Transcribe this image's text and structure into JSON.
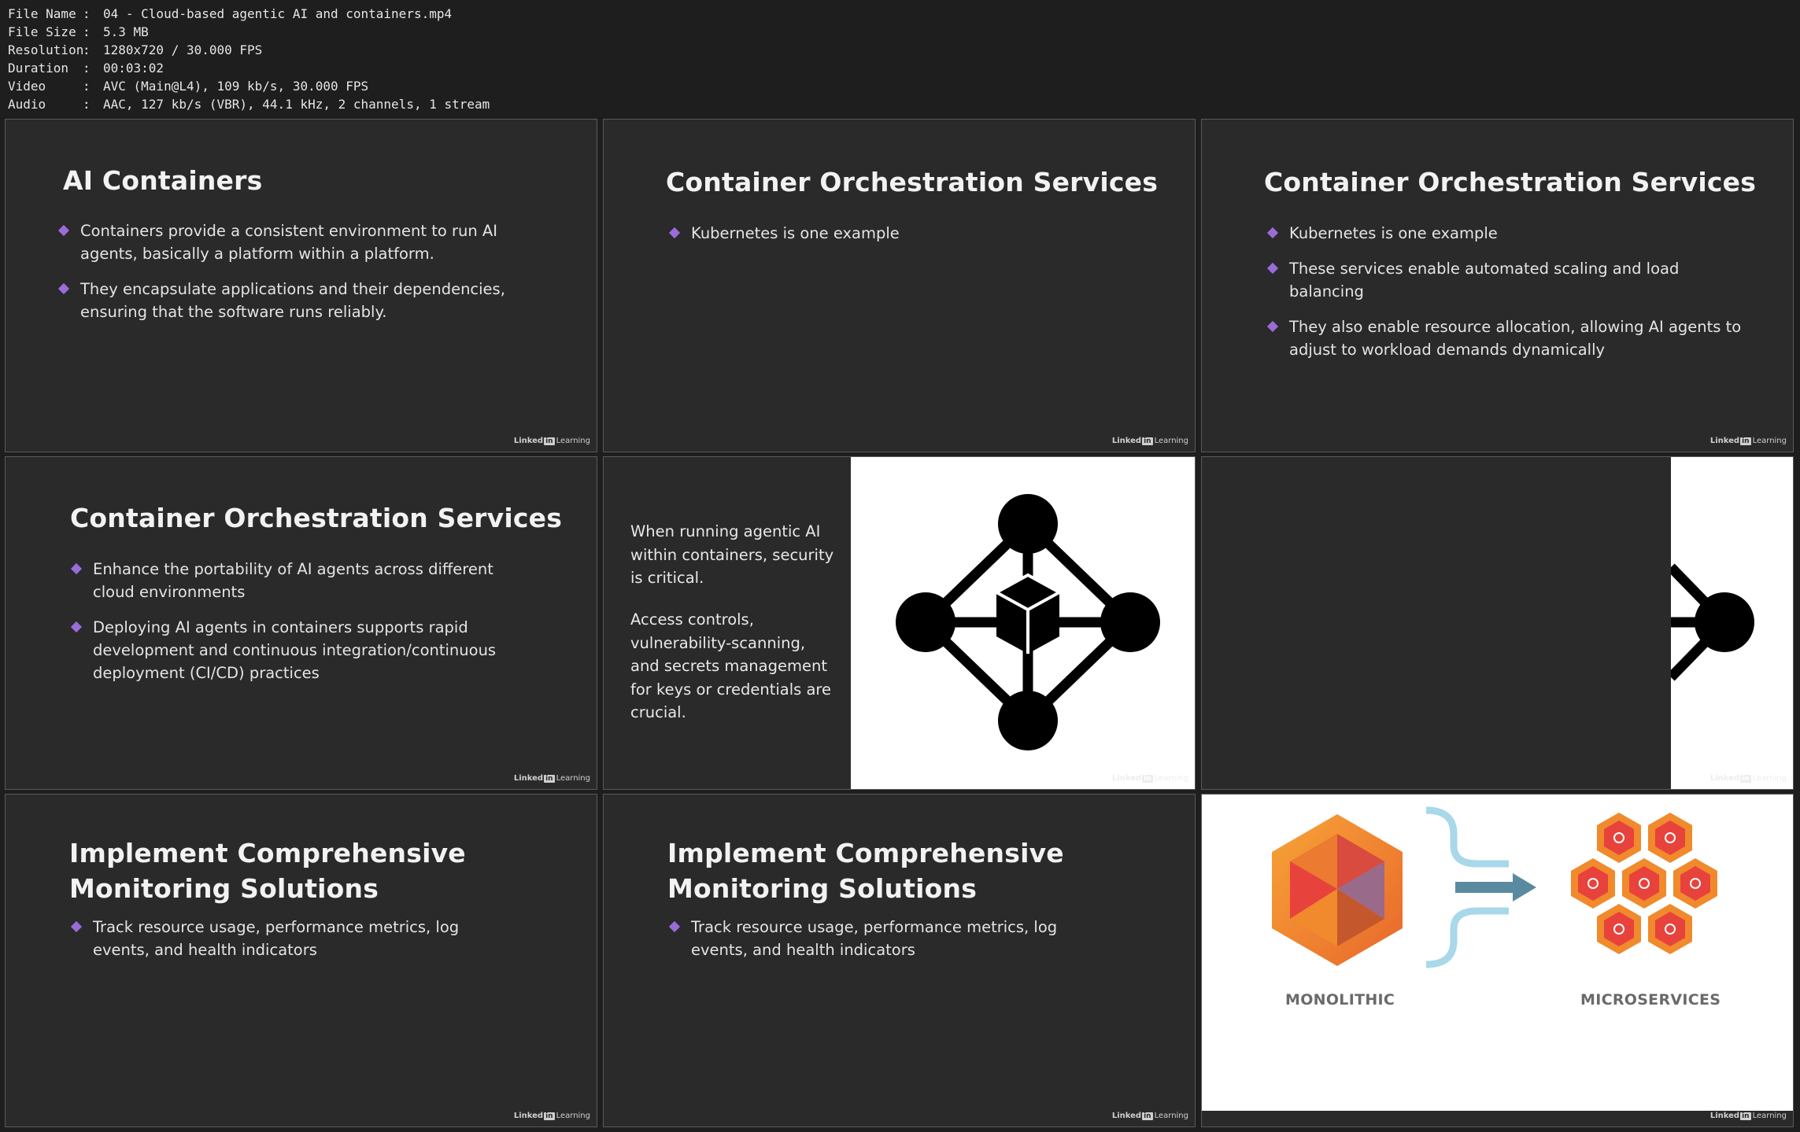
{
  "file_info": [
    {
      "key": "File Name",
      "value": "04 - Cloud-based agentic AI and containers.mp4"
    },
    {
      "key": "File Size",
      "value": "5.3 MB"
    },
    {
      "key": "Resolution",
      "value": "1280x720 / 30.000 FPS"
    },
    {
      "key": "Duration",
      "value": "00:03:02"
    },
    {
      "key": "Video",
      "value": "AVC (Main@L4), 109 kb/s, 30.000 FPS"
    },
    {
      "key": "Audio",
      "value": "AAC, 127 kb/s (VBR), 44.1 kHz, 2 channels, 1 stream"
    }
  ],
  "brand": {
    "linked": "Linked",
    "in": "in",
    "learning": "Learning"
  },
  "slides": {
    "s1": {
      "title": "AI Containers",
      "bullets": [
        "Containers provide a consistent environment to run AI agents, basically a platform within a platform.",
        "They encapsulate applications and their dependencies, ensuring that the software runs reliably."
      ]
    },
    "s2": {
      "title": "Container Orchestration Services",
      "bullets": [
        "Kubernetes is one example"
      ]
    },
    "s3": {
      "title": "Container Orchestration Services",
      "bullets": [
        "Kubernetes is one example",
        "These services enable automated scaling and load balancing",
        "They also enable resource allocation, allowing AI agents to adjust to workload demands dynamically"
      ]
    },
    "s4": {
      "title": "Container Orchestration Services",
      "bullets": [
        "Enhance the portability of AI agents across different cloud environments",
        "Deploying AI agents in containers supports rapid development and continuous integration/continuous deployment (CI/CD) practices"
      ]
    },
    "s5": {
      "para1": "When running agentic AI within containers, security is critical.",
      "para2": "Access controls, vulnerability-scanning, and secrets management for keys or credentials are crucial.",
      "icon": "container-network-icon"
    },
    "s7": {
      "title": "Implement Comprehensive Monitoring Solutions",
      "bullets": [
        "Track resource usage, performance metrics, log events, and health indicators"
      ]
    },
    "s8": {
      "title": "Implement Comprehensive Monitoring Solutions",
      "bullets": [
        "Track resource usage, performance metrics, log events, and health indicators"
      ]
    },
    "s9": {
      "left_label": "MONOLITHIC",
      "right_label": "MICROSERVICES"
    }
  },
  "colors": {
    "slide_bg": "#2a2a2a",
    "bullet_accent": "#9b6cd9",
    "hex_orange": "#f08a2c",
    "hex_red": "#e8423c",
    "arrow_blue": "#5a8aa0",
    "bracket_blue": "#a8d8ea"
  }
}
